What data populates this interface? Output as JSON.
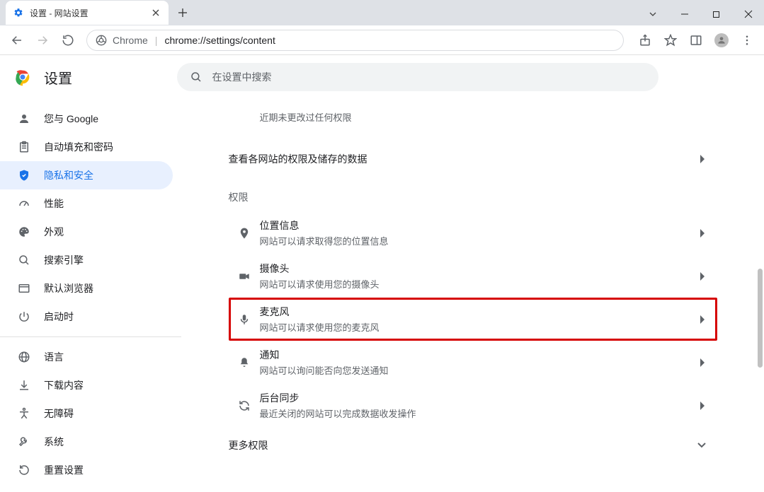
{
  "window": {
    "tab_title": "设置 - 网站设置"
  },
  "toolbar": {
    "chrome_label": "Chrome",
    "url": "chrome://settings/content"
  },
  "header": {
    "app_title": "设置",
    "search_placeholder": "在设置中搜索"
  },
  "sidebar": {
    "items": [
      {
        "label": "您与 Google"
      },
      {
        "label": "自动填充和密码"
      },
      {
        "label": "隐私和安全"
      },
      {
        "label": "性能"
      },
      {
        "label": "外观"
      },
      {
        "label": "搜索引擎"
      },
      {
        "label": "默认浏览器"
      },
      {
        "label": "启动时"
      }
    ],
    "items2": [
      {
        "label": "语言"
      },
      {
        "label": "下载内容"
      },
      {
        "label": "无障碍"
      },
      {
        "label": "系统"
      },
      {
        "label": "重置设置"
      }
    ]
  },
  "content": {
    "recent_activity": "近期未更改过任何权限",
    "view_site_data": "查看各网站的权限及储存的数据",
    "permissions_title": "权限",
    "permissions": [
      {
        "title": "位置信息",
        "sub": "网站可以请求取得您的位置信息"
      },
      {
        "title": "摄像头",
        "sub": "网站可以请求使用您的摄像头"
      },
      {
        "title": "麦克风",
        "sub": "网站可以请求使用您的麦克风"
      },
      {
        "title": "通知",
        "sub": "网站可以询问能否向您发送通知"
      },
      {
        "title": "后台同步",
        "sub": "最近关闭的网站可以完成数据收发操作"
      }
    ],
    "more_permissions": "更多权限"
  }
}
